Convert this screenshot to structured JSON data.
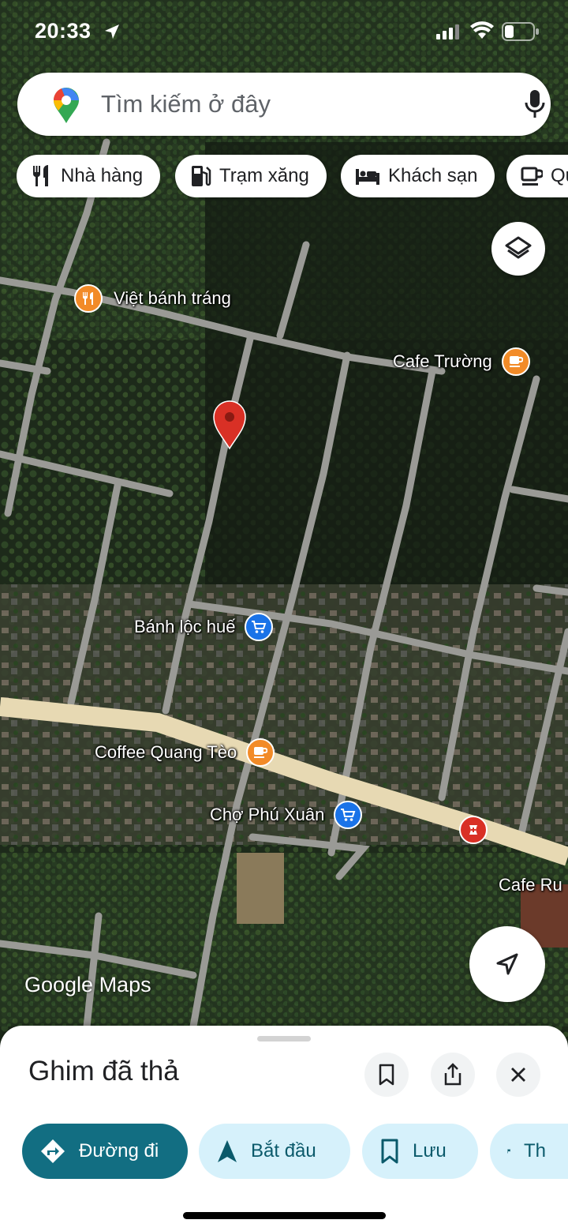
{
  "status_bar": {
    "time": "20:33"
  },
  "search": {
    "placeholder": "Tìm kiếm ở đây"
  },
  "chips": [
    {
      "label": "Nhà hàng",
      "icon": "fork-knife-icon"
    },
    {
      "label": "Trạm xăng",
      "icon": "gas-station-icon"
    },
    {
      "label": "Khách sạn",
      "icon": "bed-icon"
    },
    {
      "label": "Qu",
      "icon": "coffee-cup-icon"
    }
  ],
  "map": {
    "pois": [
      {
        "name": "Việt bánh tráng",
        "type": "restaurant",
        "color": "#f28b28"
      },
      {
        "name": "Cafe Trường",
        "type": "cafe",
        "color": "#f28b28"
      },
      {
        "name": "Bánh lộc huế",
        "type": "shopping",
        "color": "#1a73e8"
      },
      {
        "name": "Coffee Quang Tèo",
        "type": "cafe",
        "color": "#f28b28"
      },
      {
        "name": "Chợ Phú Xuân",
        "type": "shopping",
        "color": "#1a73e8"
      },
      {
        "name": "Cafe Ru",
        "type": "cafe",
        "color": "#f28b28"
      }
    ],
    "pharmacy_color": "#d93025",
    "pin_color": "#d93025",
    "logo": "Google Maps"
  },
  "sheet": {
    "title": "Ghim đã thả",
    "actions": [
      {
        "label": "Đường đi",
        "icon": "directions-icon"
      },
      {
        "label": "Bắt đầu",
        "icon": "navigation-arrow-icon"
      },
      {
        "label": "Lưu",
        "icon": "bookmark-icon"
      },
      {
        "label": "Th",
        "icon": "flag-icon"
      }
    ]
  }
}
